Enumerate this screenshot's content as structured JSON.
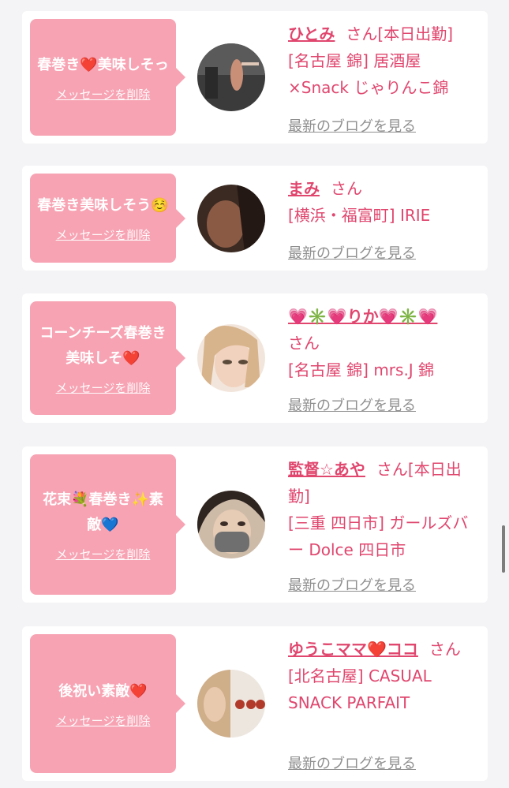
{
  "cards": [
    {
      "message": "春巻き❤️美味しそっ",
      "delete_label": "メッセージを削除",
      "name": "ひとみ",
      "san": "さん[本日出勤]",
      "shop": "[名古屋 錦] 居酒屋×Snack じゃりんこ錦",
      "blog_label": "最新のブログを見る"
    },
    {
      "message": "春巻き美味しそう☺️",
      "delete_label": "メッセージを削除",
      "name": "まみ",
      "san": "さん",
      "shop": "[横浜・福富町] IRIE",
      "blog_label": "最新のブログを見る"
    },
    {
      "message": "コーンチーズ春巻き美味しそ❤️",
      "delete_label": "メッセージを削除",
      "name": "💗✳️💗りか💗✳️💗",
      "san": "さん",
      "shop": "[名古屋 錦] mrs.J 錦",
      "blog_label": "最新のブログを見る"
    },
    {
      "message": "花束💐春巻き✨素敵💙",
      "delete_label": "メッセージを削除",
      "name": "監督☆あや",
      "san": "さん[本日出勤]",
      "shop": "[三重 四日市] ガールズバー Dolce 四日市",
      "blog_label": "最新のブログを見る"
    },
    {
      "message": "後祝い素敵❤️",
      "delete_label": "メッセージを削除",
      "name": "ゆうこママ❤️ココ",
      "san": "さん",
      "shop": "[北名古屋] CASUAL SNACK PARFAIT",
      "blog_label": "最新のブログを見る"
    }
  ]
}
